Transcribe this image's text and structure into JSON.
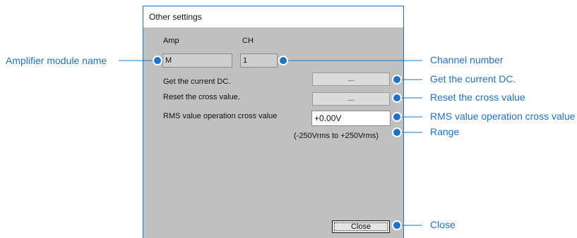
{
  "dialog": {
    "title": "Other settings",
    "amp_header": "Amp",
    "ch_header": "CH",
    "amp_value": "M",
    "ch_value": "1",
    "get_dc_label": "Get the current DC.",
    "get_dc_button": "...",
    "reset_cross_label": "Reset the cross value.",
    "reset_cross_button": "...",
    "rms_label": "RMS value operation cross value",
    "rms_value": "+0.00V",
    "range_text": "(-250Vrms to +250Vrms)",
    "close_button": "Close"
  },
  "callouts": {
    "amplifier_module_name": "Amplifier module name",
    "channel_number": "Channel number",
    "get_current_dc": "Get the current DC.",
    "reset_cross_value": "Reset the cross value",
    "rms_cross_value": "RMS value operation cross value",
    "range": "Range",
    "close": "Close"
  },
  "colors": {
    "callout_accent": "#1e73c8",
    "dialog_background": "#c0c0c0"
  }
}
